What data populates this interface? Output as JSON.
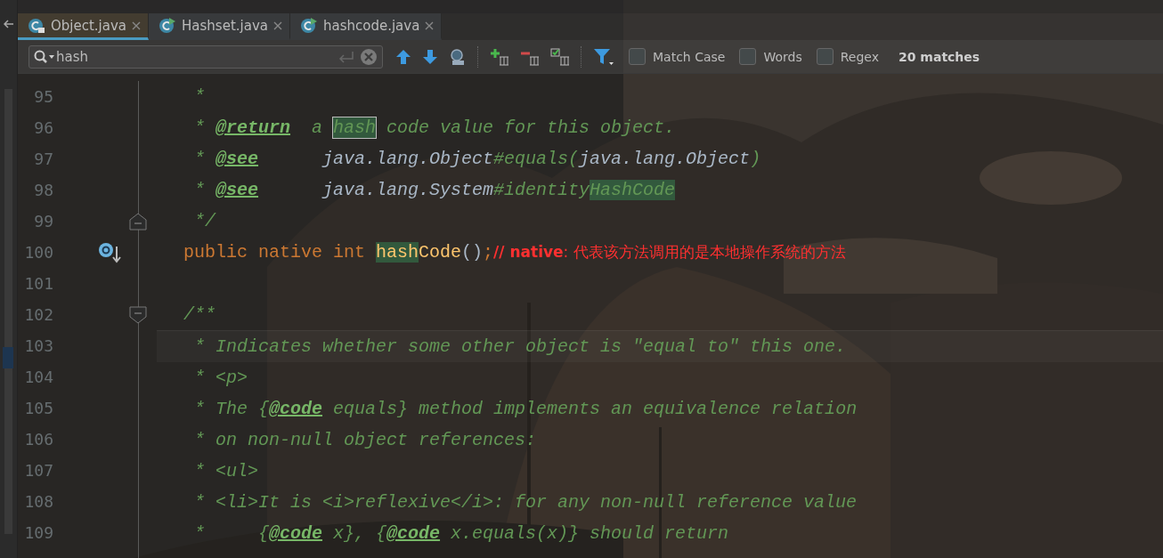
{
  "tabs": [
    {
      "label": "Object.java",
      "selected": true,
      "kind": "locked"
    },
    {
      "label": "Hashset.java",
      "selected": false,
      "kind": "runnable"
    },
    {
      "label": "hashcode.java",
      "selected": false,
      "kind": "runnable"
    }
  ],
  "search": {
    "value": "hash",
    "options": [
      {
        "label": "Match Case",
        "checked": false
      },
      {
        "label": "Words",
        "checked": false
      },
      {
        "label": "Regex",
        "checked": false
      }
    ],
    "matches": "20 matches"
  },
  "lines": [
    {
      "number": "95",
      "current": false,
      "segments": [
        {
          "kind": "comment",
          "text": " *"
        }
      ]
    },
    {
      "number": "96",
      "current": false,
      "segments": [
        {
          "kind": "comment",
          "text": " * "
        },
        {
          "kind": "tag",
          "text": "@return"
        },
        {
          "kind": "comment",
          "text": "  a "
        },
        {
          "kind": "match_selected",
          "text": "hash"
        },
        {
          "kind": "comment",
          "text": " code value for this object."
        }
      ]
    },
    {
      "number": "97",
      "current": false,
      "segments": [
        {
          "kind": "comment",
          "text": " * "
        },
        {
          "kind": "tag",
          "text": "@see"
        },
        {
          "kind": "ref",
          "text": "      java.lang.Object"
        },
        {
          "kind": "comment",
          "text": "#equals("
        },
        {
          "kind": "ref",
          "text": "java.lang.Object"
        },
        {
          "kind": "comment",
          "text": ")"
        }
      ]
    },
    {
      "number": "98",
      "current": false,
      "segments": [
        {
          "kind": "comment",
          "text": " * "
        },
        {
          "kind": "tag",
          "text": "@see"
        },
        {
          "kind": "ref",
          "text": "      java.lang.System"
        },
        {
          "kind": "comment",
          "text": "#identity"
        },
        {
          "kind": "match",
          "text": "HashCode"
        }
      ]
    },
    {
      "number": "99",
      "current": false,
      "fold_marker": {
        "kind": "end"
      },
      "segments": [
        {
          "kind": "comment",
          "text": " */"
        }
      ]
    },
    {
      "number": "100",
      "current": false,
      "gutter_icon": {
        "kind": "override"
      },
      "segments": [
        {
          "kind": "keyword",
          "text": "public native int "
        },
        {
          "kind": "match_method",
          "text": "hash"
        },
        {
          "kind": "method",
          "text": "Code"
        },
        {
          "kind": "plain",
          "text": "()"
        },
        {
          "kind": "keyword",
          "text": ";"
        },
        {
          "kind": "note_bold",
          "text": "// native"
        },
        {
          "kind": "note",
          "text": ": 代表该方法调用的是本地操作系统的方法"
        }
      ]
    },
    {
      "number": "101",
      "current": false
    },
    {
      "number": "102",
      "current": false,
      "fold_marker": {
        "kind": "start"
      },
      "segments": [
        {
          "kind": "comment",
          "text": "/**"
        }
      ]
    },
    {
      "number": "103",
      "current": true,
      "segments": [
        {
          "kind": "comment",
          "text": " * Indicates whether some other object is \"equal to\" this one."
        }
      ]
    },
    {
      "number": "104",
      "current": false,
      "segments": [
        {
          "kind": "comment",
          "text": " * <p>"
        }
      ]
    },
    {
      "number": "105",
      "current": false,
      "segments": [
        {
          "kind": "comment",
          "text": " * The {"
        },
        {
          "kind": "tag",
          "text": "@code"
        },
        {
          "kind": "comment",
          "text": " equals} method implements an equivalence relation"
        }
      ]
    },
    {
      "number": "106",
      "current": false,
      "segments": [
        {
          "kind": "comment",
          "text": " * on non-null object references:"
        }
      ]
    },
    {
      "number": "107",
      "current": false,
      "segments": [
        {
          "kind": "comment",
          "text": " * <ul>"
        }
      ]
    },
    {
      "number": "108",
      "current": false,
      "segments": [
        {
          "kind": "comment",
          "text": " * <li>It is <i>reflexive</i>: for any non-null reference value"
        }
      ]
    },
    {
      "number": "109",
      "current": false,
      "segments": [
        {
          "kind": "comment",
          "text": " *     {"
        },
        {
          "kind": "tag",
          "text": "@code"
        },
        {
          "kind": "comment",
          "text": " x}, {"
        },
        {
          "kind": "tag",
          "text": "@code"
        },
        {
          "kind": "comment",
          "text": " x.equals(x)} should return"
        }
      ]
    }
  ]
}
